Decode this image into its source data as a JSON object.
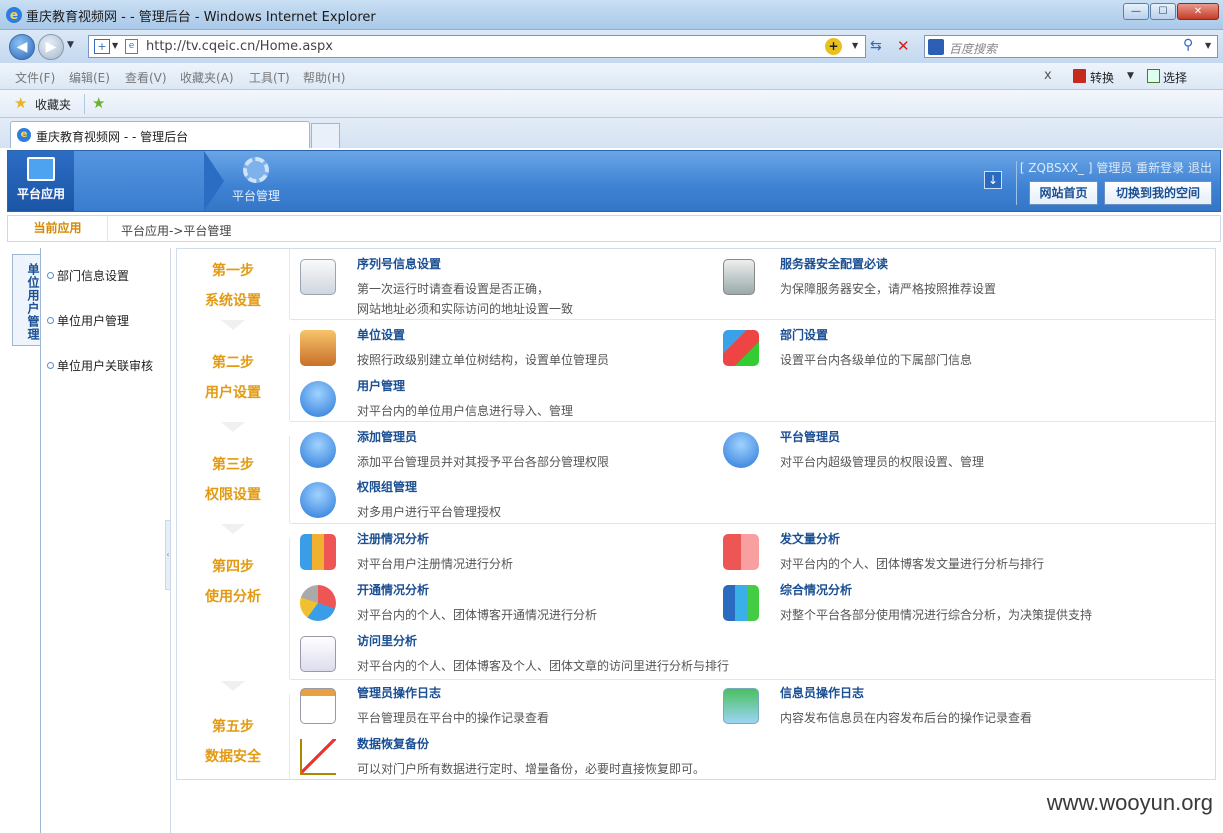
{
  "window": {
    "title": "重庆教育视频网 - - 管理后台 - Windows Internet Explorer"
  },
  "browser": {
    "url": "http://tv.cqeic.cn/Home.aspx",
    "search_placeholder": "百度搜索",
    "menu": [
      "文件(F)",
      "编辑(E)",
      "查看(V)",
      "收藏夹(A)",
      "工具(T)",
      "帮助(H)"
    ],
    "toolbar_right": {
      "close": "x",
      "convert": "转换",
      "select": "选择"
    },
    "favorites_label": "收藏夹",
    "tab_title": "重庆教育视频网 - - 管理后台"
  },
  "header": {
    "nav_app": "平台应用",
    "nav_mgmt": "平台管理",
    "user_info": "[ ZQBSXX_ ] 管理员  重新登录  退出",
    "btn_home": "网站首页",
    "btn_switch": "切换到我的空间"
  },
  "breadcrumb": {
    "current": "当前应用",
    "path": "平台应用->平台管理"
  },
  "sidebar": {
    "vertical_tab": "单位用户管理",
    "items": [
      {
        "label": "部门信息设置"
      },
      {
        "label": "单位用户管理"
      },
      {
        "label": "单位用户关联审核"
      }
    ]
  },
  "steps": [
    {
      "num": "第一步",
      "name": "系统设置"
    },
    {
      "num": "第二步",
      "name": "用户设置"
    },
    {
      "num": "第三步",
      "name": "权限设置"
    },
    {
      "num": "第四步",
      "name": "使用分析"
    },
    {
      "num": "第五步",
      "name": "数据安全"
    }
  ],
  "items": {
    "serial": {
      "title": "序列号信息设置",
      "desc": "第一次运行时请查看设置是否正确，",
      "desc2": "网站地址必须和实际访问的地址设置一致"
    },
    "server": {
      "title": "服务器安全配置必读",
      "desc": "为保障服务器安全，请严格按照推荐设置"
    },
    "unit": {
      "title": "单位设置",
      "desc": "按照行政级别建立单位树结构，设置单位管理员"
    },
    "dept": {
      "title": "部门设置",
      "desc": "设置平台内各级单位的下属部门信息"
    },
    "user": {
      "title": "用户管理",
      "desc": "对平台内的单位用户信息进行导入、管理"
    },
    "addadmin": {
      "title": "添加管理员",
      "desc": "添加平台管理员并对其授予平台各部分管理权限"
    },
    "platadmin": {
      "title": "平台管理员",
      "desc": "对平台内超级管理员的权限设置、管理"
    },
    "permgroup": {
      "title": "权限组管理",
      "desc": "对多用户进行平台管理授权"
    },
    "reg": {
      "title": "注册情况分析",
      "desc": "对平台用户注册情况进行分析"
    },
    "post": {
      "title": "发文量分析",
      "desc": "对平台内的个人、团体博客发文量进行分析与排行"
    },
    "open": {
      "title": "开通情况分析",
      "desc": "对平台内的个人、团体博客开通情况进行分析"
    },
    "overall": {
      "title": "综合情况分析",
      "desc": "对整个平台各部分使用情况进行综合分析，为决策提供支持"
    },
    "visit": {
      "title": "访问里分析",
      "desc": "对平台内的个人、团体博客及个人、团体文章的访问里进行分析与排行"
    },
    "adminlog": {
      "title": "管理员操作日志",
      "desc": "平台管理员在平台中的操作记录查看"
    },
    "infolog": {
      "title": "信息员操作日志",
      "desc": "内容发布信息员在内容发布后台的操作记录查看"
    },
    "backup": {
      "title": "数据恢复备份",
      "desc": "可以对门户所有数据进行定时、增量备份，必要时直接恢复即可。"
    }
  },
  "watermark": "www.wooyun.org"
}
